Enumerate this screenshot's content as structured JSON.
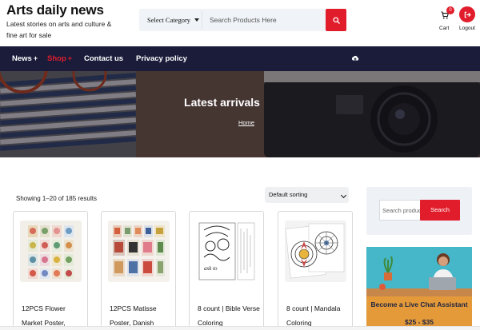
{
  "header": {
    "site_title": "Arts daily news",
    "tagline": "Latest stories on arts and culture & fine art for sale",
    "category_select": "Select Category",
    "search_placeholder": "Search Products Here",
    "cart_count": "0",
    "cart_label": "Cart",
    "logout_label": "Logout"
  },
  "nav": {
    "items": [
      {
        "label": "News",
        "suffix": "+"
      },
      {
        "label": "Shop",
        "suffix": "+"
      },
      {
        "label": "Contact us",
        "suffix": ""
      },
      {
        "label": "Privacy policy",
        "suffix": ""
      }
    ]
  },
  "hero": {
    "title": "Latest arrivals",
    "breadcrumb": "Home"
  },
  "shop": {
    "results_count": "Showing 1–20 of 185 results",
    "sort_label": "Default sorting",
    "products": [
      {
        "title": "12PCS Flower Market Poster,"
      },
      {
        "title": "12PCS Matisse Poster, Danish"
      },
      {
        "title": "8 count | Bible Verse Coloring"
      },
      {
        "title": "8 count | Mandala Coloring"
      }
    ]
  },
  "sidebar": {
    "search_placeholder": "Search products…",
    "search_button": "Search",
    "ad_headline": "Become a Live Chat Assistant",
    "ad_price": "$25 - $35"
  },
  "colors": {
    "accent": "#e11d2c",
    "nav_bg": "#1a1c3a",
    "search_bg": "#f0f3f7",
    "ad_bg": "#46b6c9"
  },
  "icons": [
    "search-icon",
    "cart-icon",
    "logout-icon",
    "chevron-down-icon",
    "cloud-upload-icon"
  ]
}
